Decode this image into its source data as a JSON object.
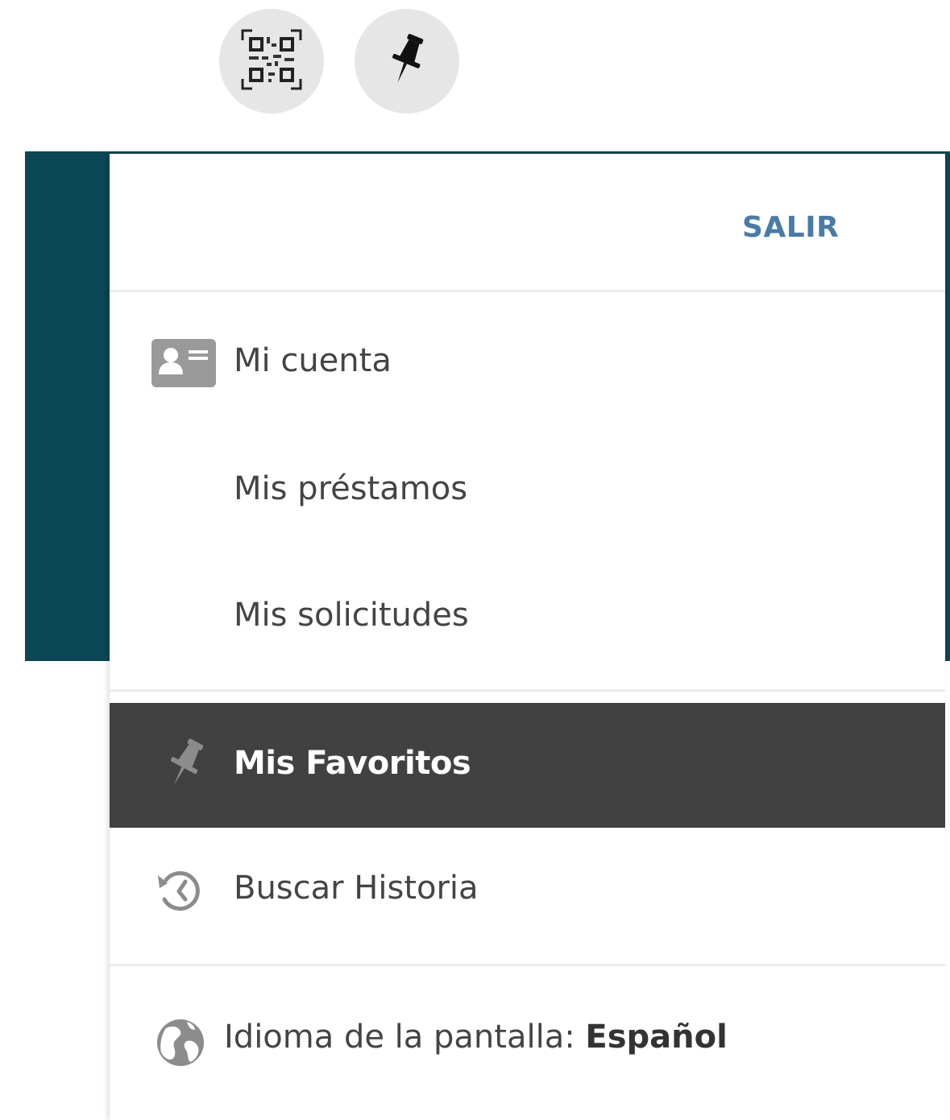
{
  "top_buttons": {
    "qr_icon": "qr-code-icon",
    "pin_icon": "pushpin-icon"
  },
  "menu": {
    "logout_label": "SALIR",
    "items": [
      {
        "label": "Mi cuenta",
        "icon": "account-card-icon"
      },
      {
        "label": "Mis préstamos"
      },
      {
        "label": "Mis solicitudes"
      },
      {
        "label": "Mis Favoritos",
        "icon": "pushpin-icon",
        "active": true
      },
      {
        "label": "Buscar Historia",
        "icon": "history-icon"
      }
    ],
    "language": {
      "prefix": "Idioma de la pantalla:",
      "value": "Español",
      "icon": "globe-icon"
    }
  },
  "colors": {
    "header_band": "#0b4654",
    "logout_text": "#4a7ba6",
    "active_item_bg": "#414141",
    "round_button_bg": "#e6e6e6"
  }
}
